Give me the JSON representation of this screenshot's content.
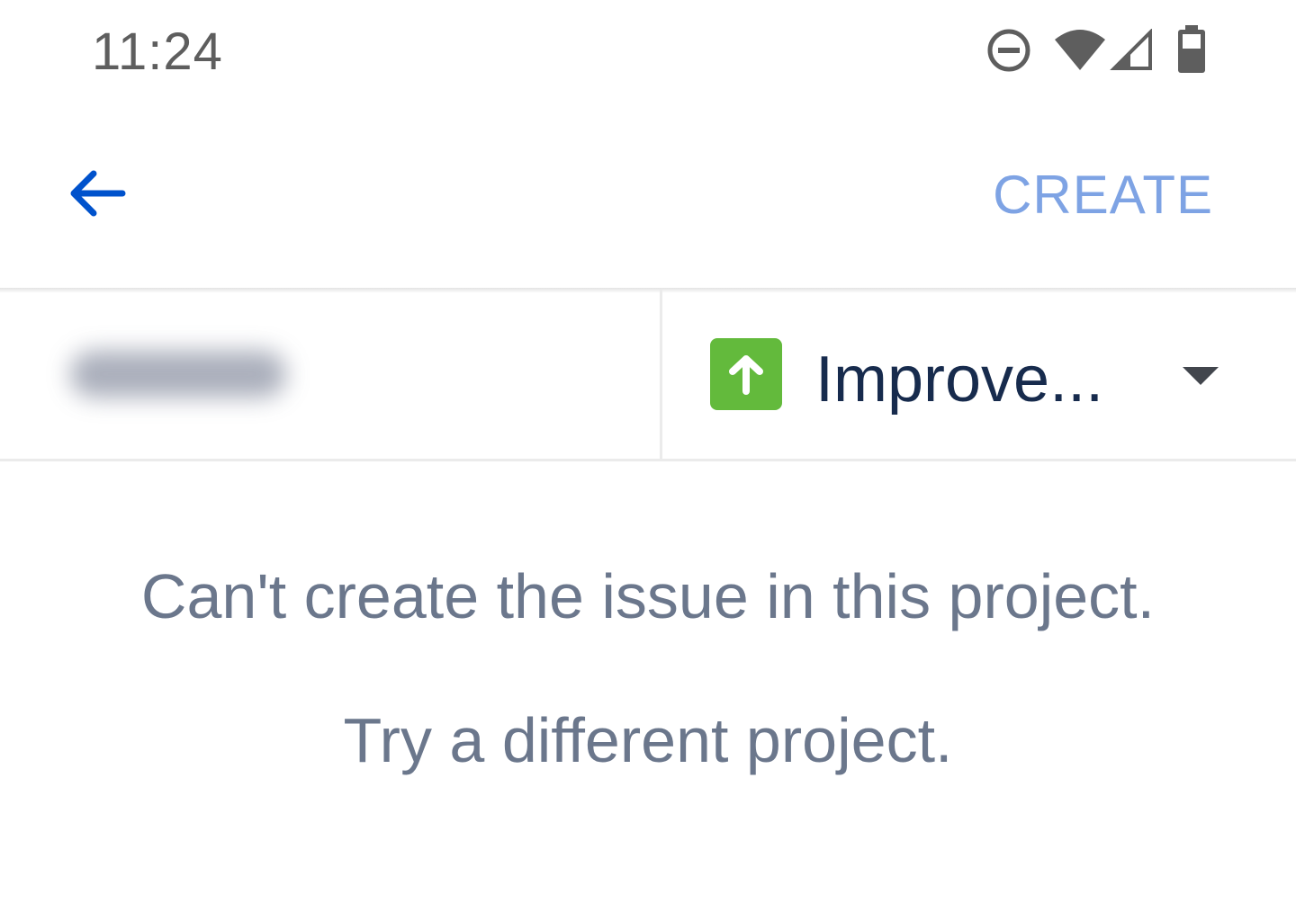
{
  "status_bar": {
    "time": "11:24",
    "icons": [
      "do-not-disturb-icon",
      "wifi-icon",
      "cell-signal-icon",
      "battery-icon"
    ]
  },
  "app_bar": {
    "back_icon": "arrow-left-icon",
    "create_label": "CREATE"
  },
  "selectors": {
    "issue_type": {
      "label": "Improve...",
      "icon": "arrow-up-icon",
      "icon_color": "#63ba3c"
    },
    "dropdown_icon": "caret-down-icon"
  },
  "message": {
    "line1": "Can't create the issue in this project.",
    "line2": "Try a different project."
  },
  "colors": {
    "accent": "#0052cc",
    "create_disabled": "#7ea3e4",
    "text_primary": "#172b4d",
    "text_secondary": "#6b778c"
  }
}
